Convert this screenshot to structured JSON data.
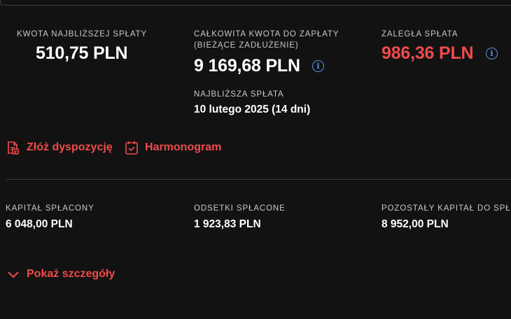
{
  "summary": {
    "next_payment": {
      "label": "KWOTA NAJBLIŻSZEJ SPŁATY",
      "value": "510,75 PLN"
    },
    "total_due": {
      "label_line1": "CAŁKOWITA KWOTA DO ZAPŁATY",
      "label_line2": "(BIEŻĄCE ZADŁUŻENIE)",
      "value": "9 169,68 PLN"
    },
    "overdue": {
      "label": "ZALEGŁA SPŁATA",
      "value": "986,36 PLN"
    },
    "next_date": {
      "label": "NAJBLIŻSZA SPŁATA",
      "value": "10 lutego 2025 (14 dni)"
    }
  },
  "actions": {
    "disposition": "Złóż dyspozycję",
    "schedule": "Harmonogram"
  },
  "details": {
    "capital_paid": {
      "label": "KAPITAŁ SPŁACONY",
      "value": "6 048,00 PLN"
    },
    "interest_paid": {
      "label": "ODSETKI SPŁACONE",
      "value": "1 923,83 PLN"
    },
    "remaining_capital": {
      "label": "POZOSTAŁY KAPITAŁ DO SPŁ",
      "value": "8 952,00 PLN"
    }
  },
  "show_details": "Pokaż szczegóły",
  "icons": {
    "info": "info-circle-icon",
    "document": "document-icon",
    "calendar": "calendar-check-icon",
    "chevron": "chevron-down-icon"
  },
  "colors": {
    "background": "#121212",
    "accent_red": "#ef4b4b",
    "info_blue": "#5b8fe6"
  }
}
